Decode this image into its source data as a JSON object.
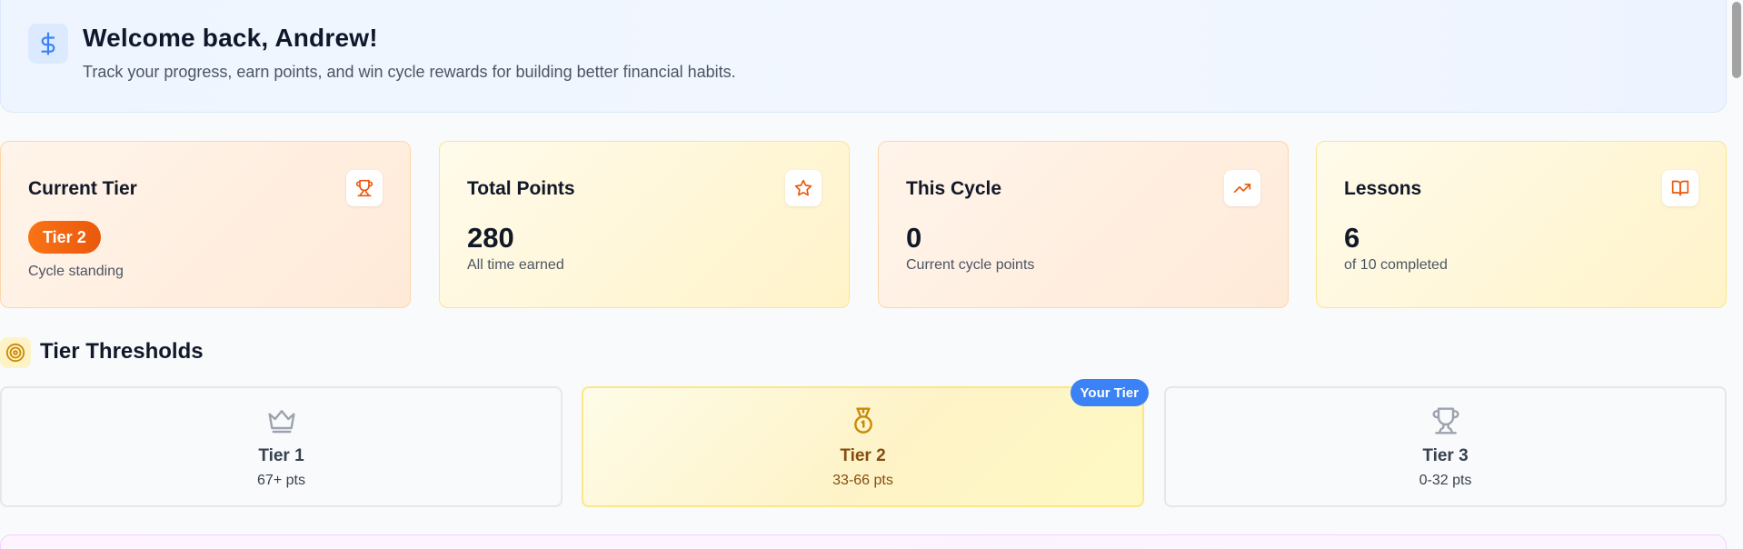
{
  "welcome": {
    "icon": "dollar-icon",
    "title": "Welcome back, Andrew!",
    "subtitle": "Track your progress, earn points, and win cycle rewards for building better financial habits."
  },
  "stats": {
    "current_tier": {
      "label": "Current Tier",
      "badge": "Tier 2",
      "caption": "Cycle standing",
      "icon": "trophy-icon"
    },
    "total_points": {
      "label": "Total Points",
      "value": "280",
      "caption": "All time earned",
      "icon": "star-icon"
    },
    "this_cycle": {
      "label": "This Cycle",
      "value": "0",
      "caption": "Current cycle points",
      "icon": "trending-up-icon"
    },
    "lessons": {
      "label": "Lessons",
      "value": "6",
      "caption": "of 10 completed",
      "icon": "book-open-icon"
    }
  },
  "thresholds": {
    "title": "Tier Thresholds",
    "icon": "target-icon",
    "your_tier_badge": "Your Tier",
    "tiers": [
      {
        "name": "Tier 1",
        "range": "67+ pts",
        "icon": "crown-icon"
      },
      {
        "name": "Tier 2",
        "range": "33-66 pts",
        "icon": "medal-icon"
      },
      {
        "name": "Tier 3",
        "range": "0-32 pts",
        "icon": "trophy-icon"
      }
    ]
  },
  "colors": {
    "accent_orange": "#ea580c",
    "accent_blue": "#3b82f6",
    "accent_gold": "#ca8a04"
  }
}
